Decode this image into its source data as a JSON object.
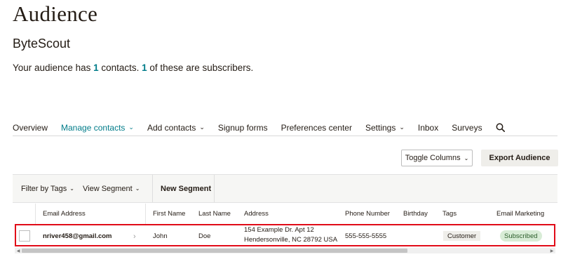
{
  "header": {
    "title": "Audience",
    "audience_name": "ByteScout",
    "summary_prefix": "Your audience has ",
    "contacts_count": "1",
    "summary_mid": " contacts. ",
    "subscribers_count": "1",
    "summary_suffix": " of these are subscribers."
  },
  "nav": {
    "items": [
      {
        "label": "Overview"
      },
      {
        "label": "Manage contacts",
        "active": true
      },
      {
        "label": "Add contacts"
      },
      {
        "label": "Signup forms"
      },
      {
        "label": "Preferences center"
      },
      {
        "label": "Settings"
      },
      {
        "label": "Inbox"
      },
      {
        "label": "Surveys"
      }
    ],
    "search_icon": "search-icon"
  },
  "toolbar": {
    "toggle_columns_label": "Toggle Columns",
    "export_label": "Export Audience"
  },
  "filters": {
    "filter_by_tags_label": "Filter by Tags",
    "view_segment_label": "View Segment",
    "new_segment_label": "New Segment"
  },
  "table": {
    "columns": [
      "Email Address",
      "First Name",
      "Last Name",
      "Address",
      "Phone Number",
      "Birthday",
      "Tags",
      "Email Marketing"
    ],
    "rows": [
      {
        "email": "nriver458@gmail.com",
        "first_name": "John",
        "last_name": "Doe",
        "address_line1": "154 Example Dr. Apt 12",
        "address_line2": "Hendersonville, NC 28792 USA",
        "phone": "555-555-5555",
        "birthday": "",
        "tag": "Customer",
        "email_marketing": "Subscribed"
      }
    ]
  },
  "colors": {
    "accent": "#007c89",
    "highlight_border": "#e10b18",
    "subscribed_bg": "#d8ecd6"
  }
}
